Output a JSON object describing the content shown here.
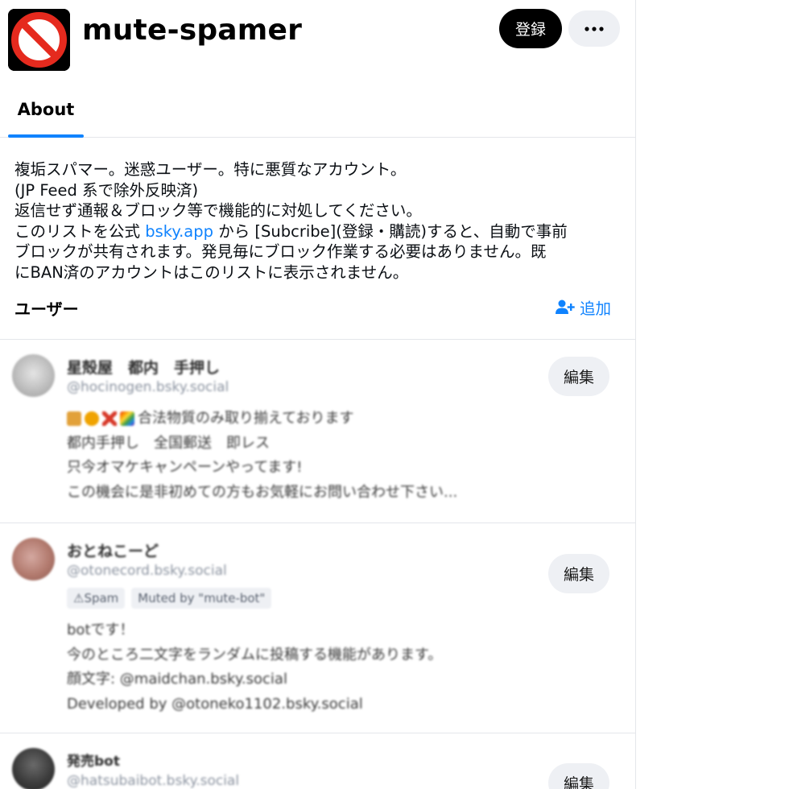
{
  "list": {
    "title": "mute-spamer",
    "subscribe_label": "登録",
    "more_icon": "ellipsis-icon"
  },
  "tabs": [
    {
      "label": "About",
      "active": true
    }
  ],
  "description": {
    "line1": "複垢スパマー。迷惑ユーザー。特に悪質なアカウント。",
    "line2": "(JP Feed 系で除外反映済)",
    "line3": "返信せず通報＆ブロック等で機能的に対処してください。",
    "line4_before": "このリストを公式 ",
    "line4_link": "bsky.app",
    "line4_after": " から [Subcribe](登録・購読)すると、自動で事前",
    "line5": "ブロックが共有されます。発見毎にブロック作業する必要はありません。既",
    "line6": "にBAN済のアカウントはこのリストに表示されません。"
  },
  "users_section": {
    "heading": "ユーザー",
    "add_label": "追加",
    "add_icon": "add-user-icon"
  },
  "members": [
    {
      "name": "星殻屋　都内　手押し",
      "handle": "@hocinogen.bsky.social",
      "bio": [
        "合法物質のみ取り揃えております",
        "都内手押し　全国郵送　即レス",
        "只今オマケキャンペーンやってます!",
        "この機会に是非初めての方もお気軽にお問い合わせ下さい..."
      ],
      "edit_label": "編集"
    },
    {
      "name": "おとねこーど",
      "handle": "@otonecord.bsky.social",
      "labels": [
        "⚠Spam",
        "Muted by \"mute-bot\""
      ],
      "bio": [
        "botです！",
        "今のところ二文字をランダムに投稿する機能があります。",
        "顔文字: @maidchan.bsky.social",
        "Developed by @otoneko1102.bsky.social"
      ],
      "edit_label": "編集"
    },
    {
      "name": "発売bot",
      "handle": "@hatsubaibot.bsky.social",
      "edit_label": "編集"
    }
  ],
  "colors": {
    "accent": "#1083fe",
    "button_dark": "#000000",
    "button_light": "#eef0f4",
    "separator": "#e4e6ea",
    "no_sign_red": "#e52a1e"
  }
}
